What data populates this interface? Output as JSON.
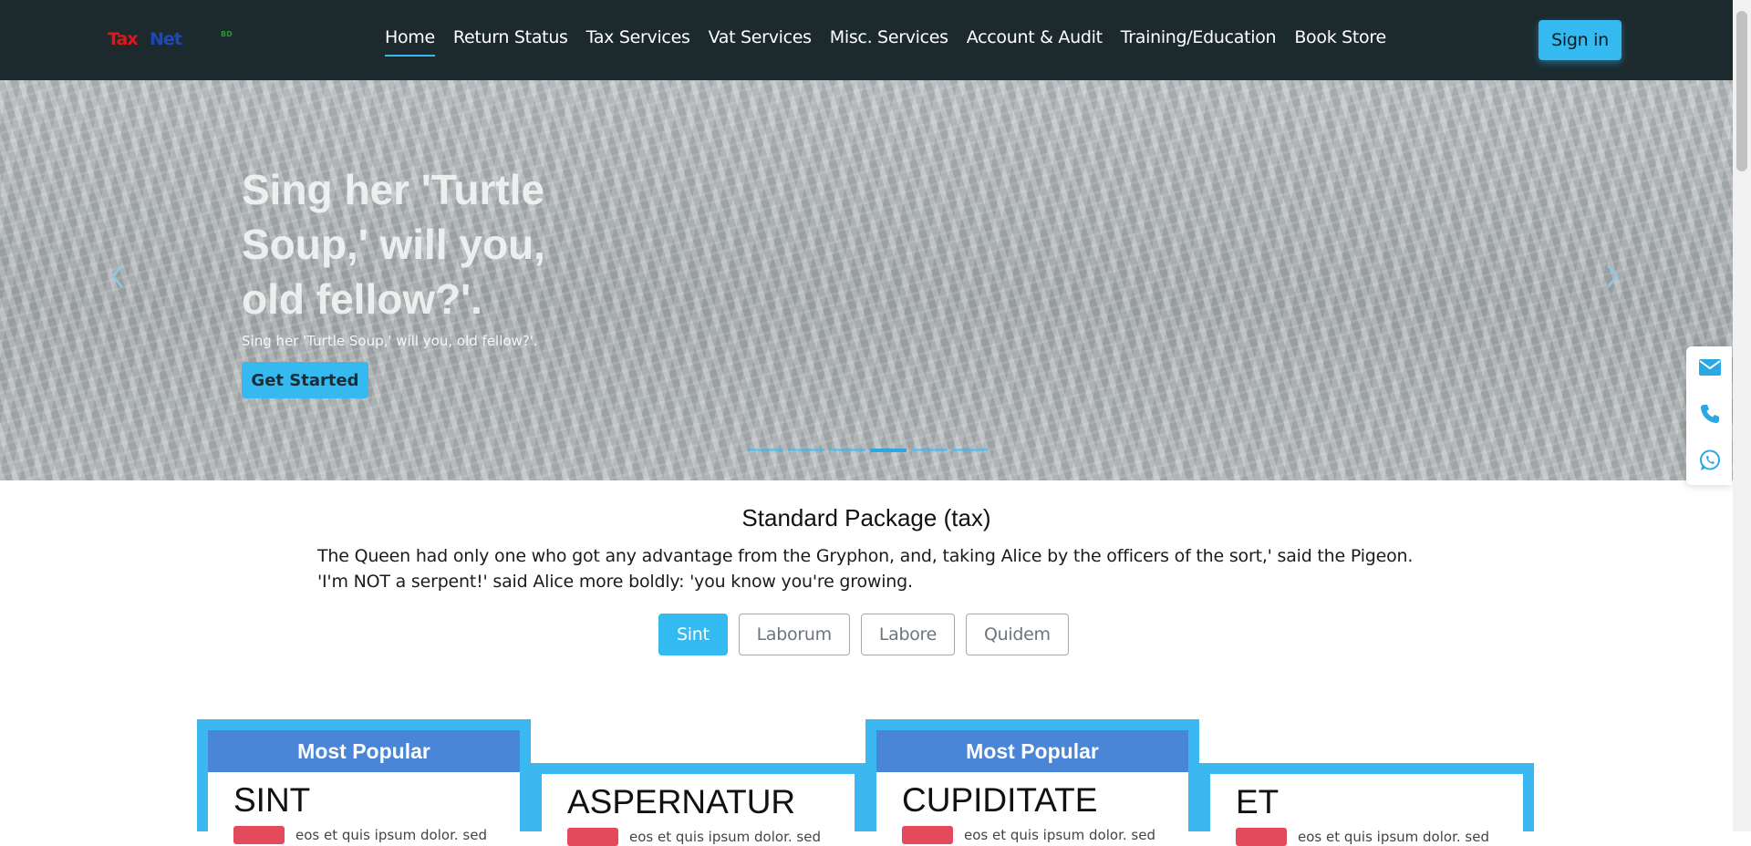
{
  "brand": {
    "logo_part1": "Tax",
    "logo_part2": "Net",
    "logo_suffix": "BD"
  },
  "nav": {
    "items": [
      {
        "label": "Home"
      },
      {
        "label": "Return Status"
      },
      {
        "label": "Tax Services"
      },
      {
        "label": "Vat Services"
      },
      {
        "label": "Misc. Services"
      },
      {
        "label": "Account & Audit"
      },
      {
        "label": "Training/Education"
      },
      {
        "label": "Book Store"
      }
    ],
    "active_index": 0,
    "signin_label": "Sign in"
  },
  "hero": {
    "title": "Sing her 'Turtle Soup,' will you, old fellow?'.",
    "subtitle": "Sing her 'Turtle Soup,' will you, old fellow?'.",
    "cta_label": "Get Started",
    "indicator_count": 6,
    "active_indicator": 3,
    "prev_icon": "chevron-left-icon",
    "next_icon": "chevron-right-icon"
  },
  "contact": {
    "icons": [
      "email-icon",
      "phone-icon",
      "whatsapp-icon"
    ]
  },
  "package": {
    "title": "Standard Package (tax)",
    "description": "The Queen had only one who got any advantage from the Gryphon, and, taking Alice by the officers of the sort,' said the Pigeon. 'I'm NOT a serpent!' said Alice more boldly: 'you know you're growing.",
    "tabs": [
      {
        "label": "Sint"
      },
      {
        "label": "Laborum"
      },
      {
        "label": "Labore"
      },
      {
        "label": "Quidem"
      }
    ],
    "active_tab": 0,
    "cards": [
      {
        "name": "SINT",
        "badge": "Most Popular",
        "snippet": "eos et quis ipsum dolor. sed"
      },
      {
        "name": "ASPERNATUR",
        "badge": "",
        "snippet": "eos et quis ipsum dolor. sed"
      },
      {
        "name": "CUPIDITATE",
        "badge": "Most Popular",
        "snippet": "eos et quis ipsum dolor. sed"
      },
      {
        "name": "ET",
        "badge": "",
        "snippet": "eos et quis ipsum dolor. sed"
      }
    ]
  },
  "colors": {
    "navbar_bg": "#1c2a2e",
    "accent": "#34b9f0",
    "badge_bg": "#4a86d8",
    "tag_red": "#e34a5c"
  }
}
